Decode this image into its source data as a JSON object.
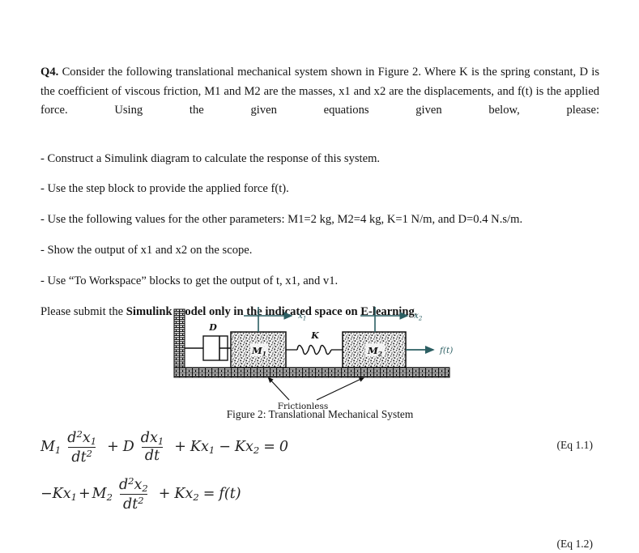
{
  "document": {
    "question_label": "Q4.",
    "intro": "Consider the following translational mechanical system shown in Figure 2. Where K is the spring constant, D is the coefficient of viscous friction, M1 and M2 are the masses, x1 and x2 are the displacements, and f(t) is the applied force. Using the given equations given below, please:",
    "bullets": [
      "- Construct a Simulink diagram to calculate the response of this system.",
      "- Use the step block to provide the applied force f(t).",
      "- Use the following values for the other parameters: M1=2 kg, M2=4 kg, K=1 N/m, and D=0.4 N.s/m.",
      "- Show the output of x1 and x2 on the scope.",
      "- Use “To Workspace” blocks to get the output of t, x1, and v1."
    ],
    "submit": {
      "prefix": "Please submit the ",
      "bold": "Simulink model only in the indicated space on E-learning",
      "suffix": "."
    }
  },
  "figure": {
    "caption": "Figure 2: Translational Mechanical System",
    "labels": {
      "damper": "D",
      "spring": "K",
      "mass1": "M",
      "mass1_sub": "1",
      "mass2": "M",
      "mass2_sub": "2",
      "disp1": "x",
      "disp1_sub": "1",
      "disp2": "x",
      "disp2_sub": "2",
      "force": "f(t)",
      "floor": "Frictionless"
    },
    "colors": {
      "arrow": "#2c5f63",
      "outline": "#1a1a1a",
      "hatch": "#111111",
      "mass_fill": "#f2f2f2"
    }
  },
  "equations": [
    {
      "id": "eq-1-1",
      "number": "(Eq 1.1)",
      "plain": "M1 d^2x1/dt^2 + D dx1/dt + Kx1 - Kx2 = 0",
      "parts": {
        "m1": "M",
        "m1_sub": "1",
        "num1": "d",
        "num1_sup": "2",
        "num1_var": "x",
        "num1_var_sub": "1",
        "den1": "dt",
        "den1_sup": "2",
        "plus1": "+",
        "d": "D",
        "num2": "dx",
        "num2_sub": "1",
        "den2": "dt",
        "plus2": "+",
        "k1": "K",
        "k1_var": "x",
        "k1_sub": "1",
        "minus": "−",
        "k2": "K",
        "k2_var": "x",
        "k2_sub": "2",
        "equals": "=",
        "rhs": "0"
      }
    },
    {
      "id": "eq-1-2",
      "number": "(Eq 1.2)",
      "plain": "-Kx1 + M2 d^2x2/dt^2 + Kx2 = f(t)",
      "parts": {
        "minus": "−",
        "k1": "K",
        "k1_var": "x",
        "k1_sub": "1",
        "plus1": "+",
        "m2": "M",
        "m2_sub": "2",
        "num1": "d",
        "num1_sup": "2",
        "num1_var": "x",
        "num1_var_sub": "2",
        "den1": "dt",
        "den1_sup": "2",
        "plus2": "+",
        "k2": "K",
        "k2_var": "x",
        "k2_sub": "2",
        "equals": "=",
        "rhs_f": "f",
        "rhs_t": "(t)"
      }
    }
  ]
}
